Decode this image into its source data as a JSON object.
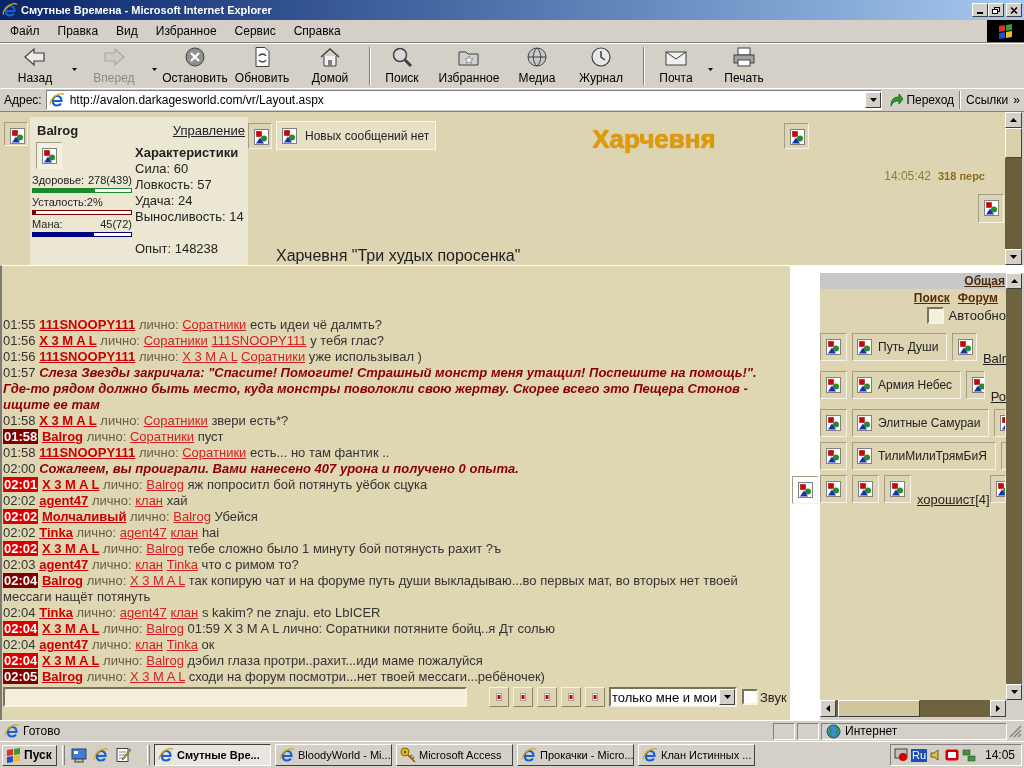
{
  "window": {
    "title": "Смутные Времена - Microsoft Internet Explorer"
  },
  "menu": [
    "Файл",
    "Правка",
    "Вид",
    "Избранное",
    "Сервис",
    "Справка"
  ],
  "toolbar": [
    [
      {
        "label": "Назад",
        "disabled": false,
        "dropdown": true
      },
      {
        "label": "Вперед",
        "disabled": true,
        "dropdown": true
      },
      {
        "label": "Остановить",
        "disabled": false,
        "dropdown": false
      },
      {
        "label": "Обновить",
        "disabled": false,
        "dropdown": false
      },
      {
        "label": "Домой",
        "disabled": false,
        "dropdown": false
      }
    ],
    [
      {
        "label": "Поиск",
        "disabled": false,
        "dropdown": false
      },
      {
        "label": "Избранное",
        "disabled": false,
        "dropdown": false
      },
      {
        "label": "Медиа",
        "disabled": false,
        "dropdown": false
      },
      {
        "label": "Журнал",
        "disabled": false,
        "dropdown": false
      }
    ],
    [
      {
        "label": "Почта",
        "disabled": false,
        "dropdown": true
      },
      {
        "label": "Печать",
        "disabled": false,
        "dropdown": false
      }
    ]
  ],
  "address_bar": {
    "label": "Адрес:",
    "url": "http://avalon.darkagesworld.com/vr/Layout.aspx",
    "go": "Переход",
    "links": "Ссылки",
    "more": "»"
  },
  "top_frame": {
    "profile": {
      "name": "Balrog",
      "manage": "Управление",
      "bars": [
        {
          "label": "Здоровье:",
          "reading": "278(439)",
          "level": 0.63,
          "color": "#1a8a2a"
        },
        {
          "label": "Усталость:2%",
          "level": 0.03,
          "color": "#800000"
        },
        {
          "label": "Мана:",
          "reading": "45(72)",
          "level": 0.62,
          "color": "#000080"
        }
      ],
      "stats_title": "Характеристики",
      "stats": [
        "Сила: 60",
        "Ловкость: 57",
        "Удача: 24",
        "Выносливость: 14"
      ],
      "experience": "Опыт: 148238"
    },
    "messages": "Новых сообщений нет",
    "location": "Харчевня",
    "clock": "14:05:42",
    "online": "318 перс",
    "room": "Харчевня \"Три худых поросенка\""
  },
  "chat": {
    "messages": [
      {
        "time": "01:55",
        "highlighted": false,
        "kind": "private",
        "author": "111SNOOPY111",
        "mode": "лично:",
        "recipients": [
          "Соратники"
        ],
        "text": "есть идеи чё далмть?"
      },
      {
        "time": "01:56",
        "highlighted": false,
        "kind": "private",
        "author": "X 3 M A L",
        "mode": "лично:",
        "recipients": [
          "Соратники",
          "111SNOOPY111"
        ],
        "text": "у тебя глас?"
      },
      {
        "time": "01:56",
        "highlighted": false,
        "kind": "private",
        "author": "111SNOOPY111",
        "mode": "лично:",
        "recipients": [
          "X 3 M A L",
          "Соратники"
        ],
        "text": "уже использывал )"
      },
      {
        "time": "01:57",
        "highlighted": false,
        "kind": "system",
        "text": "Слеза Звезды закричала: \"Спасите! Помогите! Страшный монстр меня утащил! Поспешите на помощь!\". Где-то рядом должно быть место, куда монстры поволокли свою жертву. Скорее всего это Пещера Стонов - ищите ее там"
      },
      {
        "time": "01:58",
        "highlighted": false,
        "kind": "private",
        "author": "X 3 M A L",
        "mode": "лично:",
        "recipients": [
          "Соратники"
        ],
        "text": "звери есть*?"
      },
      {
        "time": "01:58",
        "highlighted": true,
        "color": "#800000",
        "kind": "private",
        "author": "Balrog",
        "mode": "лично:",
        "recipients": [
          "Соратники"
        ],
        "text": "пуст"
      },
      {
        "time": "01:58",
        "highlighted": false,
        "kind": "private",
        "author": "111SNOOPY111",
        "mode": "лично:",
        "recipients": [
          "Соратники"
        ],
        "text": "есть... но там фантик .."
      },
      {
        "time": "02:00",
        "highlighted": false,
        "kind": "system",
        "text": "Сожалеем, вы проиграли. Вами нанесено 407 урона и получено 0 опыта."
      },
      {
        "time": "02:01",
        "highlighted": true,
        "color": "#dd0000",
        "kind": "private",
        "author": "X 3 M A L",
        "mode": "лично:",
        "recipients": [
          "Balrog"
        ],
        "text": "яж попроситл бой потянуть уёбок сцука"
      },
      {
        "time": "02:02",
        "highlighted": false,
        "kind": "private",
        "author": "agent47",
        "mode": "лично:",
        "recipients": [
          "клан"
        ],
        "text": "хай"
      },
      {
        "time": "02:02",
        "highlighted": true,
        "color": "#dd0000",
        "kind": "private",
        "author": "Молчаливый",
        "mode": "лично:",
        "recipients": [
          "Balrog"
        ],
        "text": "Убейся"
      },
      {
        "time": "02:02",
        "highlighted": false,
        "kind": "private",
        "author": "Tinka",
        "mode": "лично:",
        "recipients": [
          "agent47",
          "клан"
        ],
        "text": "hai"
      },
      {
        "time": "02:02",
        "highlighted": true,
        "color": "#dd0000",
        "kind": "private",
        "author": "X 3 M A L",
        "mode": "лично:",
        "recipients": [
          "Balrog"
        ],
        "text": "тебе сложно было 1 минуту бой потянусть рахит ?ъ"
      },
      {
        "time": "02:03",
        "highlighted": false,
        "kind": "private",
        "author": "agent47",
        "mode": "лично:",
        "recipients": [
          "клан",
          "Tinka"
        ],
        "text": "что с римом то?"
      },
      {
        "time": "02:04",
        "highlighted": true,
        "color": "#800000",
        "kind": "private",
        "author": "Balrog",
        "mode": "лично:",
        "recipients": [
          "X 3 M A L"
        ],
        "text": "так копирую чат и на форуме путь души выкладываю...во первых мат, во вторых нет твоей мессаги нащёт потянуть"
      },
      {
        "time": "02:04",
        "highlighted": false,
        "kind": "private",
        "author": "Tinka",
        "mode": "лично:",
        "recipients": [
          "agent47",
          "клан"
        ],
        "text": "s kakim? ne znaju. eto LbICER"
      },
      {
        "time": "02:04",
        "highlighted": true,
        "color": "#dd0000",
        "kind": "private",
        "author": "X 3 M A L",
        "mode": "лично:",
        "recipients": [
          "Balrog"
        ],
        "text": "01:59 X 3 M A L лично: Соратники потяните бойц..я Дт солью"
      },
      {
        "time": "02:04",
        "highlighted": false,
        "kind": "private",
        "author": "agent47",
        "mode": "лично:",
        "recipients": [
          "клан",
          "Tinka"
        ],
        "text": "ок"
      },
      {
        "time": "02:04",
        "highlighted": true,
        "color": "#dd0000",
        "kind": "private",
        "author": "X 3 M A L",
        "mode": "лично:",
        "recipients": [
          "Balrog"
        ],
        "text": "дэбил глаза протри..рахит...иди маме пожалуйся"
      },
      {
        "time": "02:05",
        "highlighted": true,
        "color": "#800000",
        "kind": "private",
        "author": "Balrog",
        "mode": "лично:",
        "recipients": [
          "X 3 M A L"
        ],
        "text": "сходи на форум посмотри...нет твоей мессаги...ребёночек)"
      }
    ],
    "filter": "только мне и мои",
    "sound": {
      "label": "Звук",
      "checked": false
    }
  },
  "side_panel": {
    "tab": "Общая",
    "links": [
      "Поиск",
      "Форум"
    ],
    "auto_refresh": {
      "label": "Автообно",
      "checked": false
    },
    "rows": [
      {
        "kind": "clan",
        "clan": "Путь Души",
        "member": "Balr"
      },
      {
        "kind": "clan",
        "clan": "Армия Небес",
        "member": "Ро"
      },
      {
        "kind": "clan",
        "clan": "Элитные Самураи"
      },
      {
        "kind": "clan",
        "clan": "ТилиМилиТрямБиЯ"
      },
      {
        "kind": "player",
        "member": "хорошист",
        "count": "[4]"
      }
    ]
  },
  "status_bar": {
    "text": "Готово",
    "zone": "Интернет"
  },
  "taskbar": {
    "start": "Пуск",
    "tasks": [
      {
        "label": "Смутные Вре...",
        "kind": "browser",
        "selected": true
      },
      {
        "label": "BloodyWorld - Mi...",
        "kind": "browser",
        "selected": false
      },
      {
        "label": "Microsoft Access",
        "kind": "database",
        "selected": false
      },
      {
        "label": "Прокачки - Micro...",
        "kind": "browser",
        "selected": false
      },
      {
        "label": "Клан Истинных ...",
        "kind": "browser",
        "selected": false
      }
    ],
    "language": "Ru",
    "clock": "14:05"
  }
}
